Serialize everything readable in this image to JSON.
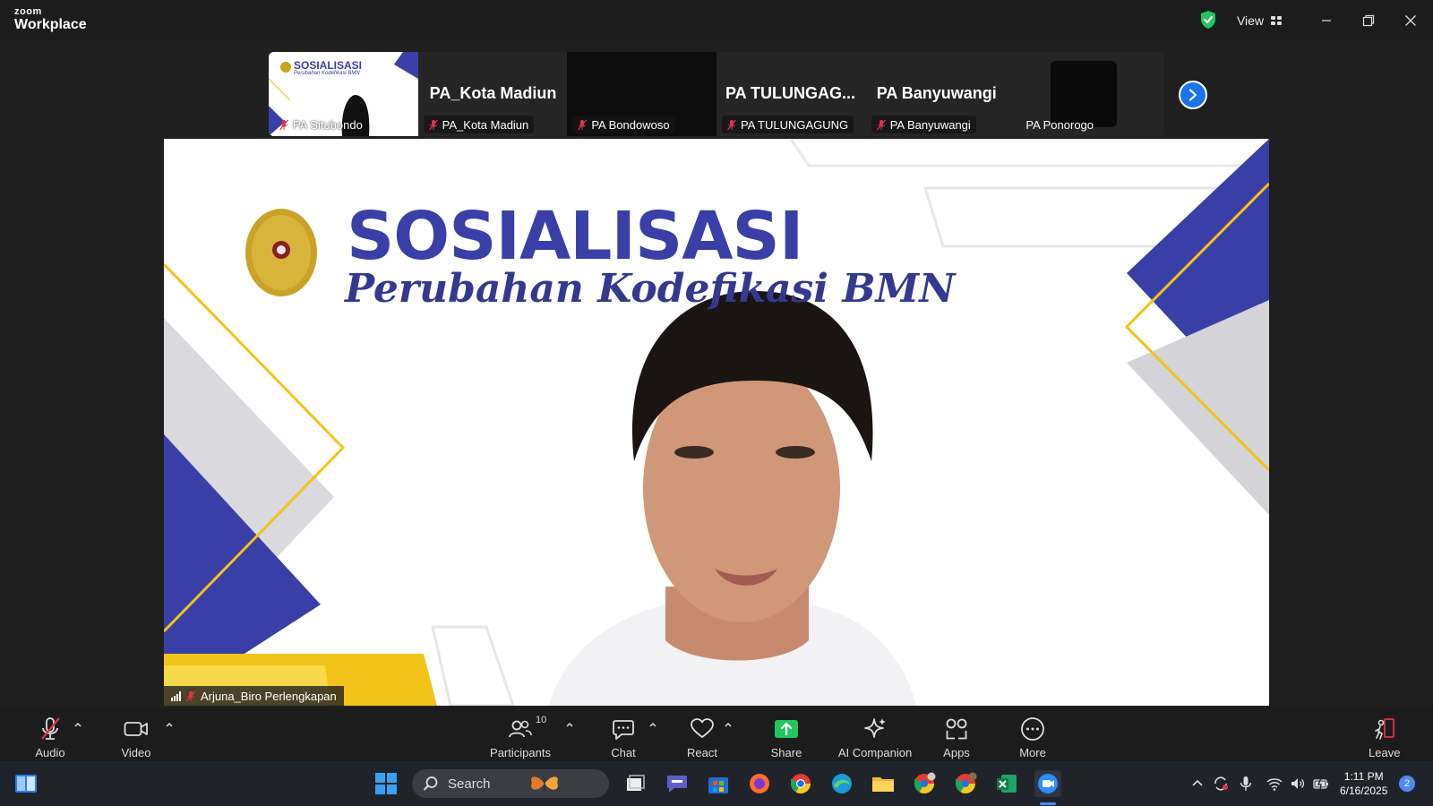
{
  "window": {
    "logo_top": "zoom",
    "logo_bottom": "Workplace",
    "view_label": "View"
  },
  "thumbnails": [
    {
      "name": "PA Situbondo",
      "display_name": "",
      "muted": true
    },
    {
      "name": "PA_Kota Madiun",
      "display_name": "PA_Kota Madiun",
      "muted": true
    },
    {
      "name": "PA Bondowoso",
      "display_name": "",
      "muted": true
    },
    {
      "name": "PA TULUNGAGUNG",
      "display_name": "PA TULUNGAG...",
      "muted": true
    },
    {
      "name": "PA Banyuwangi",
      "display_name": "PA Banyuwangi",
      "muted": true
    },
    {
      "name": "PA Ponorogo",
      "display_name": "",
      "muted": false
    }
  ],
  "thumb_slide": {
    "title": "SOSIALISASI",
    "subtitle": "Perubahan Kodefikasi BMN"
  },
  "main_video": {
    "slide_title": "SOSIALISASI",
    "slide_subtitle": "Perubahan Kodefikasi BMN",
    "speaker": "Arjuna_Biro Perlengkapan"
  },
  "toolbar": {
    "audio": "Audio",
    "video": "Video",
    "participants": "Participants",
    "participants_count": "10",
    "chat": "Chat",
    "react": "React",
    "share": "Share",
    "ai_companion": "AI Companion",
    "apps": "Apps",
    "more": "More",
    "leave": "Leave"
  },
  "taskbar": {
    "search_placeholder": "Search",
    "time": "1:11 PM",
    "date": "6/16/2025",
    "notifications": "2"
  },
  "colors": {
    "accent_blue": "#1a73e8",
    "share_green": "#22c55e",
    "muted_red": "#e0334a",
    "slide_navy": "#3a3fa8",
    "slide_gold": "#f2c318"
  }
}
